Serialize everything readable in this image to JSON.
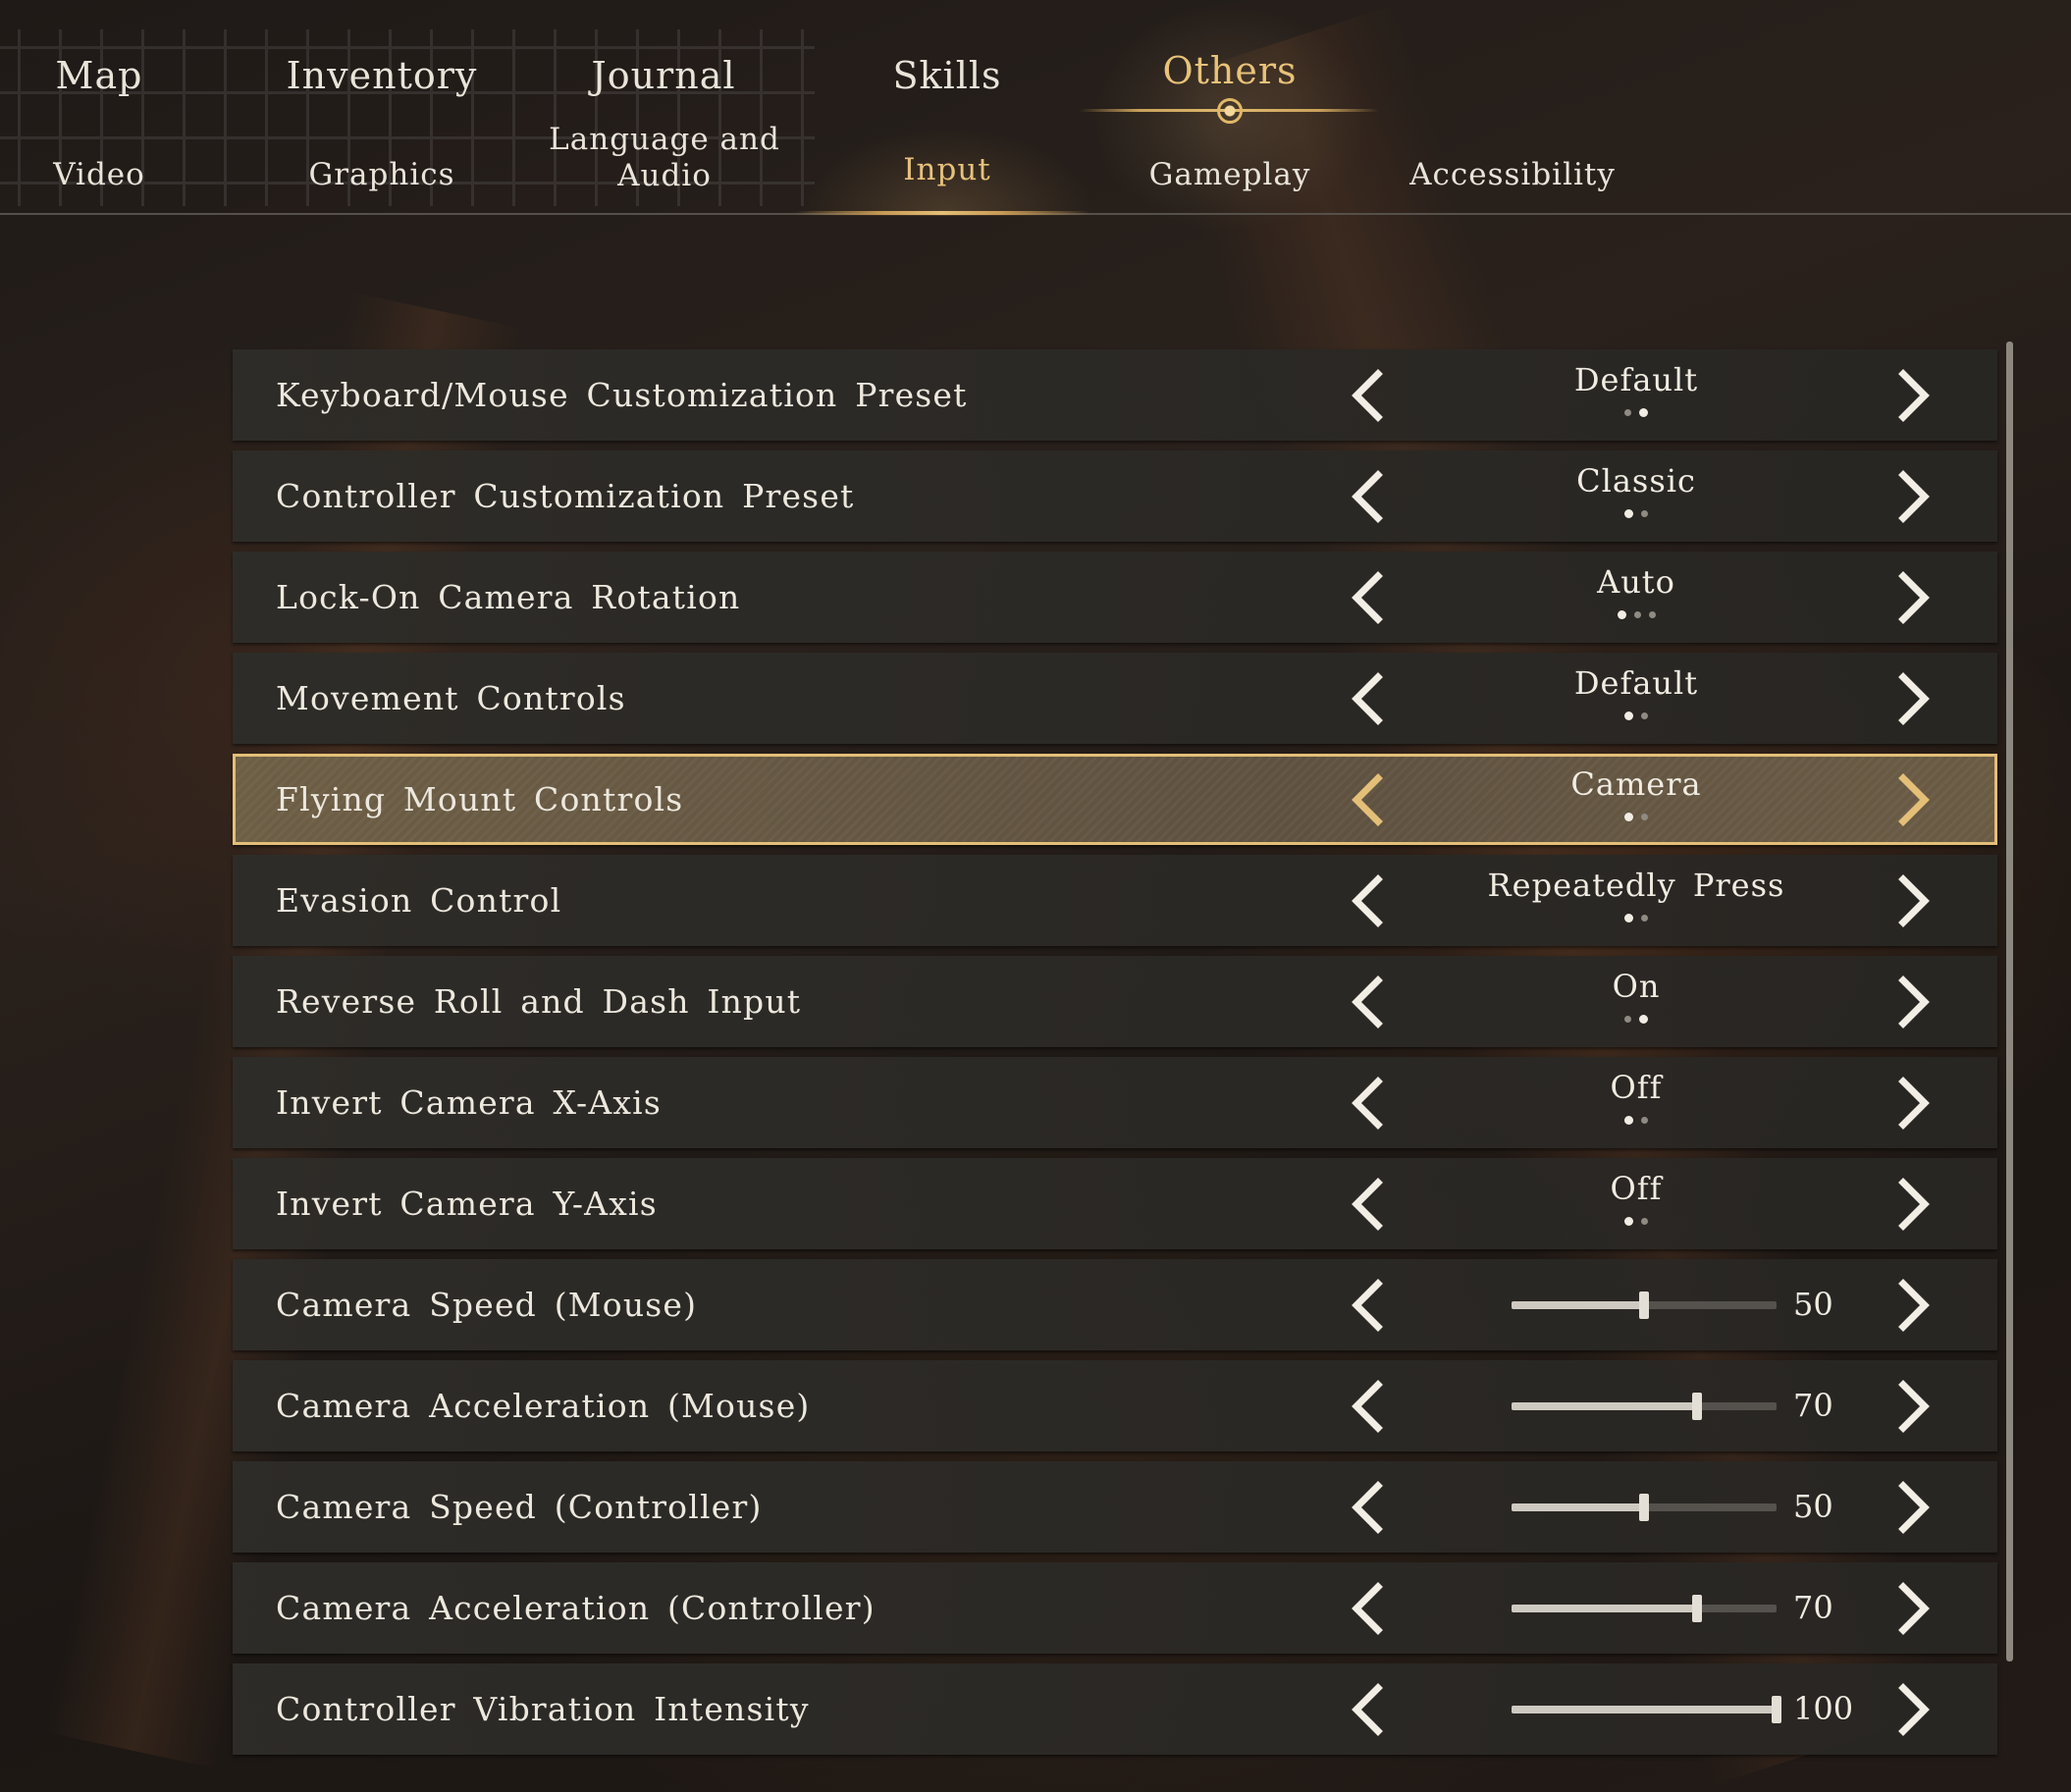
{
  "main_tabs": [
    {
      "label": "Map",
      "active": false
    },
    {
      "label": "Inventory",
      "active": false
    },
    {
      "label": "Journal",
      "active": false
    },
    {
      "label": "Skills",
      "active": false
    },
    {
      "label": "Others",
      "active": true
    }
  ],
  "sub_tabs": [
    {
      "label": "Video",
      "active": false
    },
    {
      "label": "Graphics",
      "active": false
    },
    {
      "label": "Language and\nAudio",
      "active": false
    },
    {
      "label": "Input",
      "active": true
    },
    {
      "label": "Gameplay",
      "active": false
    },
    {
      "label": "Accessibility",
      "active": false
    }
  ],
  "colors": {
    "accent": "#e3bf78",
    "text": "#ede8de",
    "row_bg": "#2e2c28"
  },
  "icons": {
    "prev": "chevron-left-icon",
    "next": "chevron-right-icon"
  },
  "settings": [
    {
      "label": "Keyboard/Mouse Customization Preset",
      "kind": "option",
      "value": "Default",
      "option_count": 2,
      "option_index": 1,
      "selected": false
    },
    {
      "label": "Controller Customization Preset",
      "kind": "option",
      "value": "Classic",
      "option_count": 2,
      "option_index": 0,
      "selected": false
    },
    {
      "label": "Lock-On Camera Rotation",
      "kind": "option",
      "value": "Auto",
      "option_count": 3,
      "option_index": 0,
      "selected": false
    },
    {
      "label": "Movement Controls",
      "kind": "option",
      "value": "Default",
      "option_count": 2,
      "option_index": 0,
      "selected": false
    },
    {
      "label": "Flying Mount Controls",
      "kind": "option",
      "value": "Camera",
      "option_count": 2,
      "option_index": 0,
      "selected": true
    },
    {
      "label": "Evasion Control",
      "kind": "option",
      "value": "Repeatedly Press",
      "option_count": 2,
      "option_index": 0,
      "selected": false
    },
    {
      "label": "Reverse Roll and Dash Input",
      "kind": "option",
      "value": "On",
      "option_count": 2,
      "option_index": 1,
      "selected": false
    },
    {
      "label": "Invert Camera X-Axis",
      "kind": "option",
      "value": "Off",
      "option_count": 2,
      "option_index": 0,
      "selected": false
    },
    {
      "label": "Invert Camera Y-Axis",
      "kind": "option",
      "value": "Off",
      "option_count": 2,
      "option_index": 0,
      "selected": false
    },
    {
      "label": "Camera Speed (Mouse)",
      "kind": "slider",
      "value": "50",
      "min": 0,
      "max": 100,
      "selected": false
    },
    {
      "label": "Camera Acceleration (Mouse)",
      "kind": "slider",
      "value": "70",
      "min": 0,
      "max": 100,
      "selected": false
    },
    {
      "label": "Camera Speed (Controller)",
      "kind": "slider",
      "value": "50",
      "min": 0,
      "max": 100,
      "selected": false
    },
    {
      "label": "Camera Acceleration (Controller)",
      "kind": "slider",
      "value": "70",
      "min": 0,
      "max": 100,
      "selected": false
    },
    {
      "label": "Controller Vibration Intensity",
      "kind": "slider",
      "value": "100",
      "min": 0,
      "max": 100,
      "selected": false
    }
  ]
}
